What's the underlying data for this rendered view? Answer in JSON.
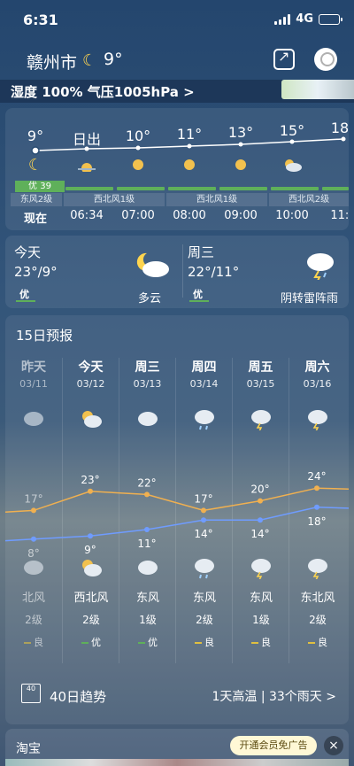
{
  "status": {
    "time": "6:31",
    "network": "4G"
  },
  "header": {
    "city": "赣州市",
    "temp": "9°"
  },
  "infobar": {
    "text": "湿度 100%  气压1005hPa >"
  },
  "hourly": {
    "temps": [
      "9°",
      "日出",
      "10°",
      "11°",
      "13°",
      "15°",
      "18°"
    ],
    "times": [
      "现在",
      "06:34",
      "07:00",
      "08:00",
      "09:00",
      "10:00",
      "11:0"
    ],
    "aqi": "优 39",
    "winds": [
      "东风2级",
      "西北风1级",
      "西北风1级",
      "西北风2级"
    ]
  },
  "today": {
    "title": "今天",
    "temp": "23°/9°",
    "aqi": "优",
    "cond": "多云"
  },
  "tomorrow": {
    "title": "周三",
    "temp": "22°/11°",
    "aqi": "优",
    "cond": "阴转雷阵雨"
  },
  "forecast": {
    "title": "15日预报",
    "days": [
      {
        "day": "昨天",
        "date": "03/11",
        "high": "17°",
        "low": "8°",
        "wdir": "北风",
        "wlvl": "2级",
        "aqi": "良",
        "aqi_color": "#e0c040",
        "icon": "cloudy-icon",
        "past": true
      },
      {
        "day": "今天",
        "date": "03/12",
        "high": "23°",
        "low": "9°",
        "wdir": "西北风",
        "wlvl": "2级",
        "aqi": "优",
        "aqi_color": "#5fb05a",
        "icon": "partly-cloudy-icon",
        "past": false
      },
      {
        "day": "周三",
        "date": "03/13",
        "high": "22°",
        "low": "11°",
        "wdir": "东风",
        "wlvl": "1级",
        "aqi": "优",
        "aqi_color": "#5fb05a",
        "icon": "cloudy-icon",
        "past": false
      },
      {
        "day": "周四",
        "date": "03/14",
        "high": "17°",
        "low": "14°",
        "wdir": "东风",
        "wlvl": "2级",
        "aqi": "良",
        "aqi_color": "#e0c040",
        "icon": "rain-icon",
        "past": false
      },
      {
        "day": "周五",
        "date": "03/15",
        "high": "20°",
        "low": "14°",
        "wdir": "东风",
        "wlvl": "1级",
        "aqi": "良",
        "aqi_color": "#e0c040",
        "icon": "thunder-rain-icon",
        "past": false
      },
      {
        "day": "周六",
        "date": "03/16",
        "high": "24°",
        "low": "18°",
        "wdir": "东北风",
        "wlvl": "2级",
        "aqi": "良",
        "aqi_color": "#e0c040",
        "icon": "thunder-rain-icon",
        "past": false
      }
    ],
    "highs": [
      17,
      23,
      22,
      17,
      20,
      24
    ],
    "lows": [
      8,
      9,
      11,
      14,
      14,
      18
    ],
    "trend_label": "40日趋势",
    "trend_right": "1天高温 | 33个雨天 >",
    "trend_icon_text": "40"
  },
  "ad": {
    "title": "淘宝",
    "button": "开通会员免广告"
  },
  "colors": {
    "high_line": "#f0b050",
    "low_line": "#6f9cff",
    "aqi_good": "#5fb05a",
    "aqi_fair": "#e0c040"
  }
}
